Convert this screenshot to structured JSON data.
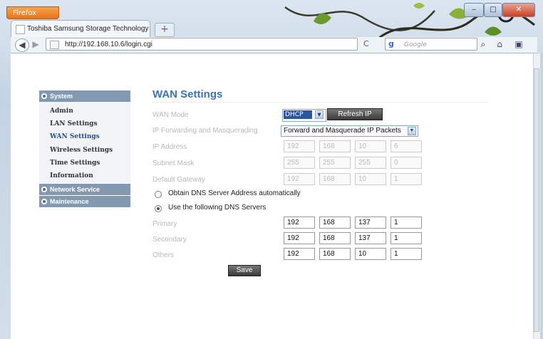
{
  "browser": {
    "menu_button": "Firefox",
    "tab_title": "Toshiba Samsung Storage Technology",
    "new_tab": "+",
    "url": "http://192.168.10.6/login.cgi",
    "search_placeholder": "Google",
    "window_buttons": {
      "minimize": "‒",
      "maximize": "□",
      "close": "✕"
    },
    "back": "◀",
    "forward": "▶",
    "reload": "C",
    "home": "⌂"
  },
  "sidebar": {
    "sections": [
      {
        "label": "System",
        "items": [
          "Admin",
          "LAN Settings",
          "WAN Settings",
          "Wireless Settings",
          "Time Settings",
          "Information"
        ],
        "active": "WAN Settings"
      },
      {
        "label": "Network Service"
      },
      {
        "label": "Maintenance"
      }
    ]
  },
  "form": {
    "title": "WAN Settings",
    "wan_mode_label": "WAN Mode",
    "wan_mode_value": "DHCP",
    "refresh_ip": "Refresh IP",
    "ip_forwarding_label": "IP Forwarding and Masquerading",
    "ip_forwarding_value": "Forward and Masquerade IP Packets",
    "ip_address_label": "IP Address",
    "ip_address": [
      "192",
      "168",
      "10",
      "6"
    ],
    "subnet_mask_label": "Subnet Mask",
    "subnet_mask": [
      "255",
      "255",
      "255",
      "0"
    ],
    "gateway_label": "Default Gateway",
    "gateway": [
      "192",
      "168",
      "10",
      "1"
    ],
    "dns_auto_label": "Obtain DNS Server Address automatically",
    "dns_manual_label": "Use the following DNS Servers",
    "dns_mode": "manual",
    "primary_label": "Primary",
    "primary": [
      "192",
      "168",
      "137",
      "1"
    ],
    "secondary_label": "Secondary",
    "secondary": [
      "192",
      "168",
      "137",
      "1"
    ],
    "others_label": "Others",
    "others": [
      "192",
      "168",
      "10",
      "1"
    ],
    "save": "Save"
  },
  "colors": {
    "accent": "#3a73b6",
    "sidebar_header": "#8399b1",
    "firefox_orange": "#e6731a"
  }
}
